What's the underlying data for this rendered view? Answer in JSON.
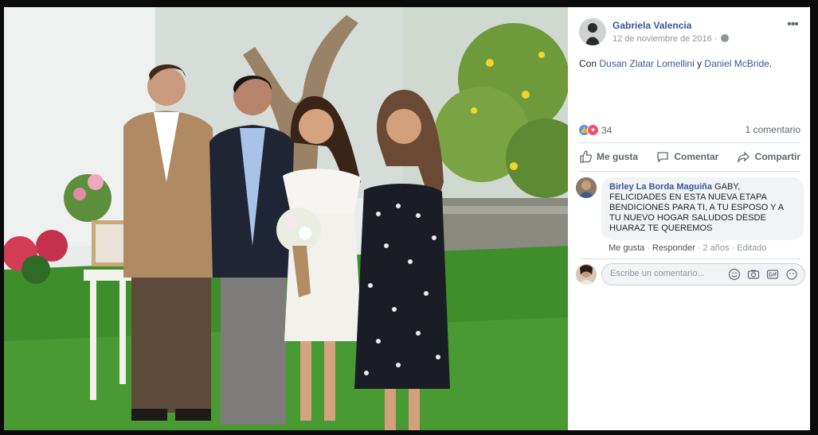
{
  "post": {
    "author": "Gabriela Valencia",
    "date": "12 de noviembre de 2016",
    "privacy_icon": "globe-icon",
    "tagline_prefix": "Con ",
    "tagged_1": "Dusan Zlatar Lomellini",
    "tagline_join": " y ",
    "tagged_2": "Daniel McBride",
    "tagline_suffix": "."
  },
  "stats": {
    "reaction_icons": [
      "like-icon",
      "love-icon"
    ],
    "reactions_count": "34",
    "comments_count": "1 comentario"
  },
  "actions": {
    "like": "Me gusta",
    "comment": "Comentar",
    "share": "Compartir"
  },
  "comment": {
    "author": "Birley La Borda Maguiña",
    "text": "GABY, FELICIDADES EN ESTA NUEVA ETAPA BENDICIONES PARA TI, A TU ESPOSO Y A TU NUEVO HOGAR SALUDOS DESDE HUARAZ TE QUEREMOS",
    "like": "Me gusta",
    "reply": "Responder",
    "time": "2 años",
    "edited": "Editado",
    "sep": "·"
  },
  "composer": {
    "placeholder": "Escribe un comentario...",
    "icons": [
      "emoji-icon",
      "camera-icon",
      "gif-icon",
      "sticker-icon"
    ]
  },
  "colors": {
    "link": "#385898",
    "like_blue": "#5890ff",
    "love_red": "#f25268"
  }
}
